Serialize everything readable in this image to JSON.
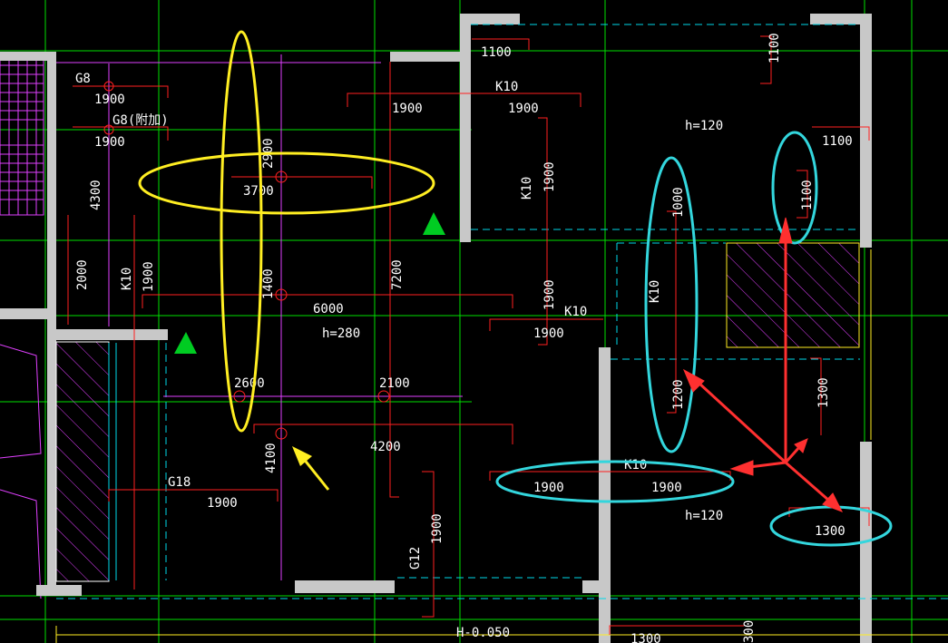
{
  "colors": {
    "background": "#000000",
    "grid_line": "#00e000",
    "wall": "#c8c8c8",
    "rebar": "#ff2020",
    "dim": "#e040ff",
    "highlight_yellow": "#ffee22",
    "highlight_cyan": "#33d6dd",
    "arrow_red": "#ff3030",
    "marker_green": "#00cc22"
  },
  "labels": {
    "g8_top": "G8",
    "g8_1900_a": "1900",
    "g8_bottom": "G8(附加)",
    "g8_1900_b": "1900",
    "dim_4300": "4300",
    "dim_2900": "2900",
    "dim_3700": "3700",
    "dim_2000": "2000",
    "k10_left": "K10",
    "dim_1900_left_v": "1900",
    "dim_1400": "1400",
    "dim_6000": "6000",
    "h280": "h=280",
    "dim_2600": "2600",
    "dim_2100": "2100",
    "dim_4100": "4100",
    "dim_4200": "4200",
    "g18": "G18",
    "dim_1900_g18": "1900",
    "g12": "G12",
    "dim_1900_g12": "1900",
    "h_minus": "H-0.050",
    "dim_1900_top": "1900",
    "dim_7200": "7200",
    "dim_1100_topleft": "1100",
    "k10_top": "K10",
    "k10_top_1900": "1900",
    "k10_v_mid": "K10",
    "dim_1900_v_mid": "1900",
    "dim_1900_v_mid2": "1900",
    "k10_mid_h": "K10",
    "dim_1900_mid_h": "1900",
    "dim_1100_top_right_v": "1100",
    "h120_top": "h=120",
    "dim_1100_right": "1100",
    "dim_1100_v_right": "1100",
    "dim_1000": "1000",
    "k10_cyan_v": "K10",
    "dim_1200": "1200",
    "dim_1300_v": "1300",
    "k10_cyan_h": "K10",
    "dim_1900_cyan_a": "1900",
    "dim_1900_cyan_b": "1900",
    "h120_bottom": "h=120",
    "dim_1300_h": "1300",
    "dim_1300_bottom": "1300",
    "dim_300_bottom": "300"
  }
}
